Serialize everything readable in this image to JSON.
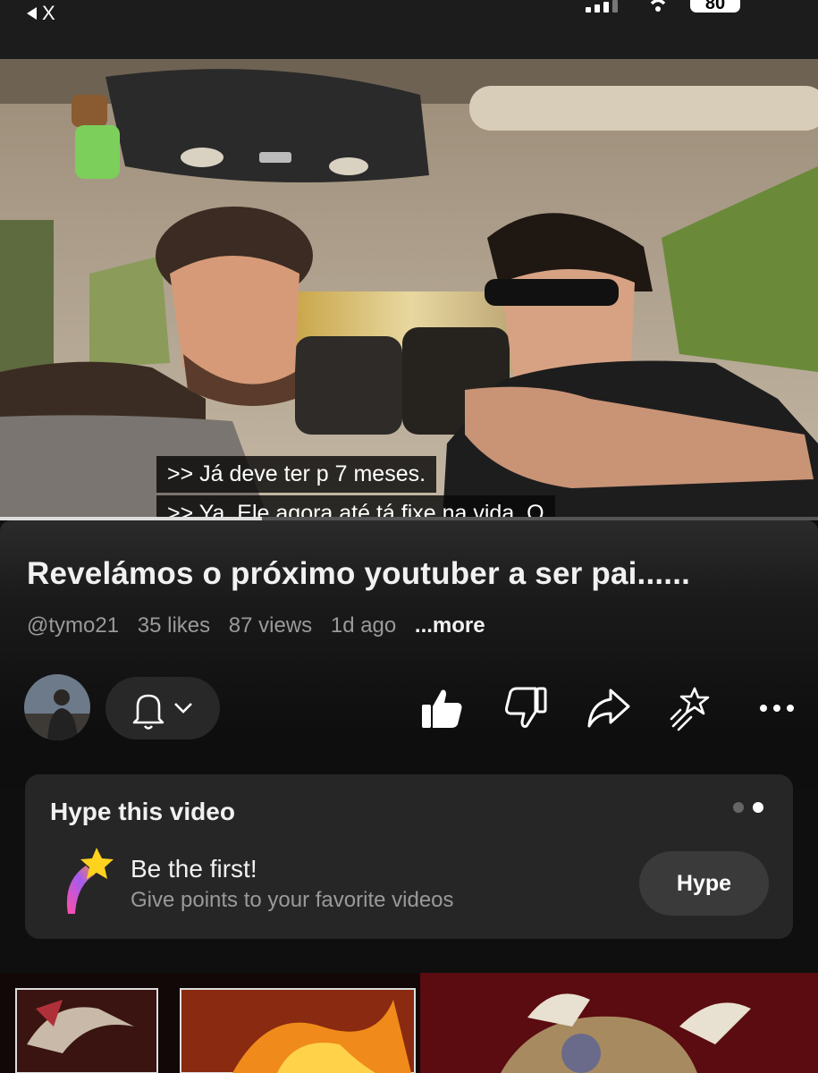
{
  "status_bar": {
    "back_label": "X",
    "battery": "80"
  },
  "video": {
    "captions": [
      ">> Já deve ter p 7 meses.",
      ">> Ya. Ele agora até tá fixe na vida. O"
    ],
    "progress": 0.32
  },
  "details": {
    "title": "Revelámos o próximo youtuber a ser pai......",
    "channel": "@tymo21",
    "likes": "35 likes",
    "views": "87 views",
    "age": "1d ago",
    "more": "...more"
  },
  "actions": {
    "icons": [
      "like-icon",
      "dislike-icon",
      "share-icon",
      "remix-icon",
      "more-icon"
    ]
  },
  "hype": {
    "title": "Hype this video",
    "headline": "Be the first!",
    "subtext": "Give points to your favorite videos",
    "button": "Hype"
  },
  "colors": {
    "background": "#0f0f0f",
    "card": "#262626",
    "button": "#3a3a3a",
    "muted_text": "#9a9a9a"
  }
}
